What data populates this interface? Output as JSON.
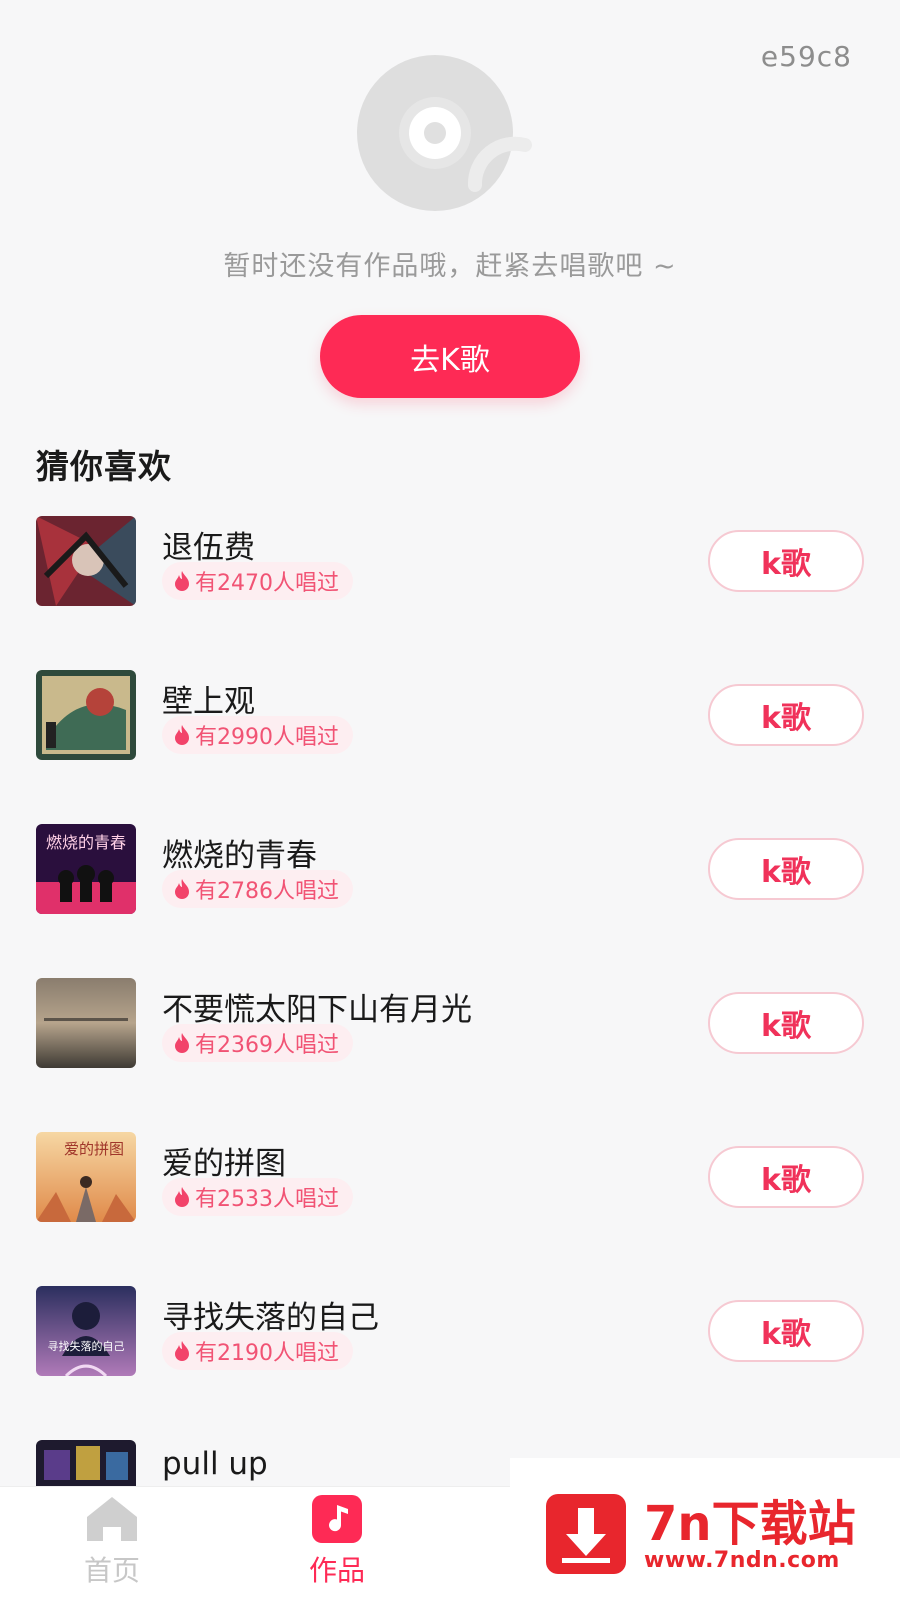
{
  "header": {
    "user_id": "e59c8"
  },
  "empty_state": {
    "message": "暂时还没有作品哦，赶紧去唱歌吧 ~",
    "cta_label": "去K歌"
  },
  "recommend": {
    "title": "猜你喜欢",
    "k_label": "k歌",
    "songs": [
      {
        "title": "退伍费",
        "sung": "有2470人唱过"
      },
      {
        "title": "壁上观",
        "sung": "有2990人唱过"
      },
      {
        "title": "燃烧的青春",
        "sung": "有2786人唱过",
        "cover_text": "燃烧的青春"
      },
      {
        "title": "不要慌太阳下山有月光",
        "sung": "有2369人唱过"
      },
      {
        "title": "爱的拼图",
        "sung": "有2533人唱过",
        "cover_text": "爱的拼图"
      },
      {
        "title": "寻找失落的自己",
        "sung": "有2190人唱过",
        "cover_text": "寻找失落的自己"
      },
      {
        "title": "pull up"
      }
    ]
  },
  "bottom_nav": {
    "items": [
      {
        "label": "首页",
        "icon": "home-icon",
        "active": false
      },
      {
        "label": "作品",
        "icon": "music-note-icon",
        "active": true
      }
    ]
  },
  "watermark": {
    "title": "7n下载站",
    "url": "www.7ndn.com"
  },
  "colors": {
    "accent": "#fe2a55",
    "badge_bg": "#fdeef1",
    "badge_text": "#f15374"
  }
}
